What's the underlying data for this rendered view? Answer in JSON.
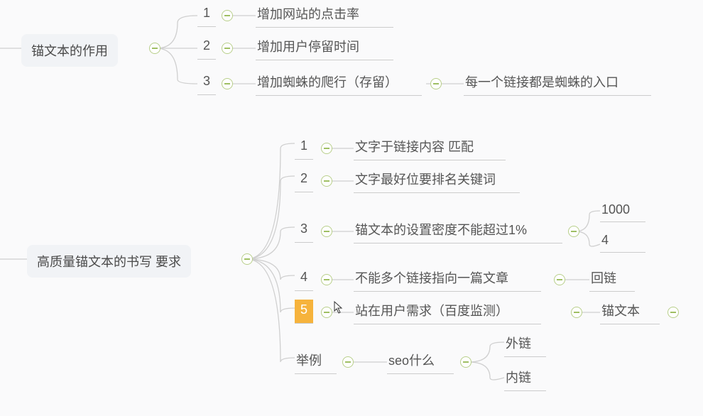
{
  "roots": {
    "r1": "锚文本的作用",
    "r2": "高质量锚文本的书写 要求"
  },
  "group1": {
    "n1": {
      "num": "1",
      "text": "增加网站的点击率"
    },
    "n2": {
      "num": "2",
      "text": "增加用户停留时间"
    },
    "n3": {
      "num": "3",
      "text": "增加蜘蛛的爬行（存留）",
      "child": "每一个链接都是蜘蛛的入口"
    }
  },
  "group2": {
    "n1": {
      "num": "1",
      "text": "文字于链接内容 匹配"
    },
    "n2": {
      "num": "2",
      "text": "文字最好位要排名关键词"
    },
    "n3": {
      "num": "3",
      "text": "锚文本的设置密度不能超过1%",
      "sub": {
        "a": "1000",
        "b": "4"
      }
    },
    "n4": {
      "num": "4",
      "text": "不能多个链接指向一篇文章",
      "child": "回链"
    },
    "n5": {
      "num": "5",
      "text": "站在用户需求（百度监测）",
      "child": "锚文本"
    },
    "ex": {
      "label": "举例",
      "text": "seo什么",
      "sub": {
        "a": "外链",
        "b": "内链"
      }
    }
  },
  "icons": {
    "collapse": "collapse"
  }
}
